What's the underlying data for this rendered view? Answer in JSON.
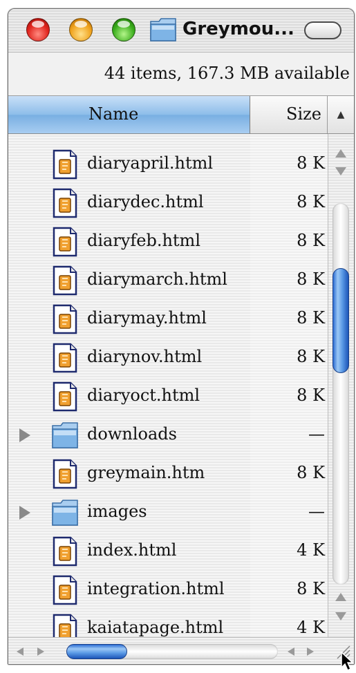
{
  "window": {
    "title": "Greymou...",
    "status": "44 items, 167.3 MB available"
  },
  "columns": {
    "name": "Name",
    "size": "Size",
    "sort_indicator": "▲"
  },
  "files": [
    {
      "name": "diaryapril.html",
      "size": "8 K",
      "kind": "file-icon",
      "expandable": false
    },
    {
      "name": "diarydec.html",
      "size": "8 K",
      "kind": "file-icon",
      "expandable": false
    },
    {
      "name": "diaryfeb.html",
      "size": "8 K",
      "kind": "file-icon",
      "expandable": false
    },
    {
      "name": "diarymarch.html",
      "size": "8 K",
      "kind": "file-icon",
      "expandable": false
    },
    {
      "name": "diarymay.html",
      "size": "8 K",
      "kind": "file-icon",
      "expandable": false
    },
    {
      "name": "diarynov.html",
      "size": "8 K",
      "kind": "file-icon",
      "expandable": false
    },
    {
      "name": "diaryoct.html",
      "size": "8 K",
      "kind": "file-icon",
      "expandable": false
    },
    {
      "name": "downloads",
      "size": "—",
      "kind": "folder-icon",
      "expandable": true
    },
    {
      "name": "greymain.htm",
      "size": "8 K",
      "kind": "file-icon",
      "expandable": false
    },
    {
      "name": "images",
      "size": "—",
      "kind": "folder-icon",
      "expandable": true
    },
    {
      "name": "index.html",
      "size": "4 K",
      "kind": "file-icon",
      "expandable": false
    },
    {
      "name": "integration.html",
      "size": "8 K",
      "kind": "file-icon",
      "expandable": false
    },
    {
      "name": "kaiatapage.html",
      "size": "4 K",
      "kind": "file-icon",
      "expandable": false
    }
  ],
  "colors": {
    "selected_column": "#8dbde9",
    "scroll_thumb": "#2c6cd3",
    "close": "#e0231c",
    "minimize": "#f0a21c",
    "zoom": "#3aad1c"
  }
}
